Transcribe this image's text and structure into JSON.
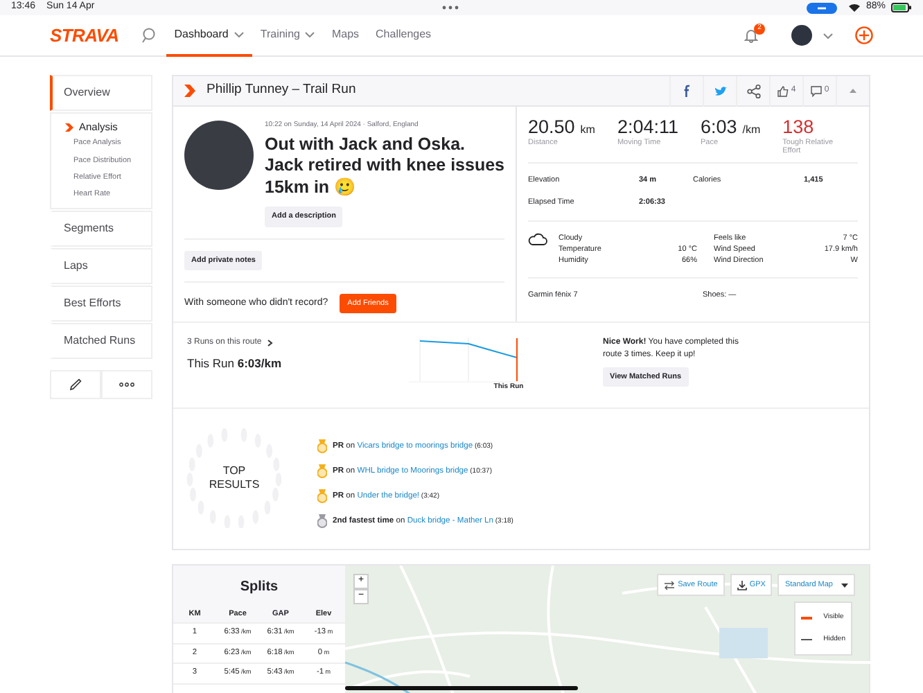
{
  "status_bar": {
    "time": "13:46",
    "date": "Sun 14 Apr",
    "battery": "88%"
  },
  "nav": {
    "logo": "STRAVA",
    "items": [
      {
        "label": "Dashboard",
        "selected": true,
        "menu": true
      },
      {
        "label": "Training",
        "selected": false,
        "menu": true
      },
      {
        "label": "Maps",
        "selected": false,
        "menu": false
      },
      {
        "label": "Challenges",
        "selected": false,
        "menu": false
      }
    ],
    "notifications": "2"
  },
  "sidebar": {
    "items": [
      {
        "label": "Overview",
        "selected": true,
        "children": [
          {
            "label": "Analysis",
            "children": [
              {
                "label": "Pace Analysis"
              },
              {
                "label": "Pace Distribution"
              },
              {
                "label": "Relative Effort"
              },
              {
                "label": "Heart Rate"
              }
            ]
          }
        ]
      },
      {
        "label": "Segments",
        "selected": false
      },
      {
        "label": "Laps",
        "selected": false
      },
      {
        "label": "Best Efforts",
        "selected": false
      },
      {
        "label": "Matched Runs",
        "selected": false
      }
    ]
  },
  "activity": {
    "header": "Phillip Tunney – Trail Run",
    "kudos": "4",
    "comments": "0",
    "meta": "10:22 on Sunday, 14 April 2024 · Salford, England",
    "title": "Out with Jack and Oska. Jack retired with knee issues 15km in 🥲",
    "add_description": "Add a description",
    "add_notes": "Add private notes",
    "friends_prompt": "With someone who didn't record?",
    "add_friends": "Add Friends",
    "stats": [
      {
        "value": "20.50",
        "unit": "km",
        "label": "Distance",
        "kind": "plain"
      },
      {
        "value": "2:04:11",
        "label": "Moving Time",
        "kind": "plain"
      },
      {
        "value": "6:03",
        "unit": "/km",
        "label": "Pace",
        "kind": "plain"
      },
      {
        "value": "138",
        "label": "Tough Relative Effort",
        "kind": "effort"
      }
    ],
    "details": [
      {
        "label": "Elevation",
        "value": "34 m"
      },
      {
        "label": "Calories",
        "value": "1,415"
      },
      {
        "label": "Elapsed Time",
        "value": "2:06:33"
      }
    ],
    "weather": {
      "condition": "Cloudy",
      "left": [
        {
          "label": "Temperature",
          "value": "10 °C"
        },
        {
          "label": "Humidity",
          "value": "66%"
        }
      ],
      "right": [
        {
          "label": "Feels like",
          "value": "7 °C"
        },
        {
          "label": "Wind Speed",
          "value": "17.9 km/h"
        },
        {
          "label": "Wind Direction",
          "value": "W"
        }
      ]
    },
    "device": "Garmin fēnix 7",
    "shoes": "Shoes: —"
  },
  "matched": {
    "link": "3 Runs on this route",
    "this_run": "This Run **6:03/km**",
    "chart_label": "This Run",
    "message": "**Nice Work!** You have completed this route 3 times. Keep it up!",
    "button": "View Matched Runs"
  },
  "top_results": {
    "title": "TOP RESULTS",
    "items": [
      {
        "kind": "pr",
        "achievement": "PR",
        "on": "on",
        "segment": "Vicars bridge to moorings bridge",
        "time": "(6:03)"
      },
      {
        "kind": "pr",
        "achievement": "PR",
        "on": "on",
        "segment": "WHL bridge to Moorings bridge",
        "time": "(10:37)"
      },
      {
        "kind": "pr",
        "achievement": "PR",
        "on": "on",
        "segment": "Under the bridge!",
        "time": "(3:42)"
      },
      {
        "kind": "second",
        "achievement": "2nd fastest time",
        "on": "on",
        "segment": "Duck bridge - Mather Ln",
        "time": "(3:18)"
      }
    ]
  },
  "splits": {
    "title": "Splits",
    "columns": [
      "KM",
      "Pace",
      "GAP",
      "Elev"
    ],
    "rows": [
      [
        {
          "v": "1"
        },
        {
          "v": "6:33",
          "u": "/km"
        },
        {
          "v": "6:31",
          "u": "/km"
        },
        {
          "v": "-13",
          "u": "m"
        }
      ],
      [
        {
          "v": "2"
        },
        {
          "v": "6:23",
          "u": "/km"
        },
        {
          "v": "6:18",
          "u": "/km"
        },
        {
          "v": "0",
          "u": "m"
        }
      ],
      [
        {
          "v": "3"
        },
        {
          "v": "5:45",
          "u": "/km"
        },
        {
          "v": "5:43",
          "u": "/km"
        },
        {
          "v": "-1",
          "u": "m"
        }
      ]
    ]
  },
  "map": {
    "zoom_in": "+",
    "zoom_out": "−",
    "save_route": "Save Route",
    "gpx": "GPX",
    "map_type": "Standard Map",
    "legend": [
      {
        "label": "Visible",
        "color": "#fc4c02"
      },
      {
        "label": "Hidden",
        "color": "#555555"
      }
    ]
  }
}
